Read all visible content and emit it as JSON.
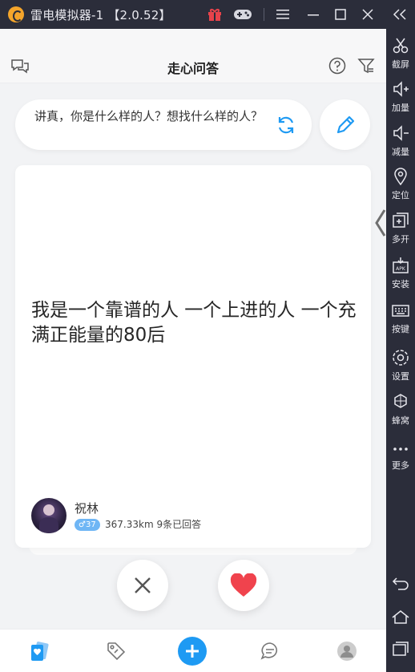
{
  "window": {
    "title": "雷电模拟器-1 【2.0.52】",
    "icons": [
      "app-logo-icon",
      "gift-icon",
      "gamepad-icon",
      "menu-icon",
      "minimize-icon",
      "maximize-icon",
      "close-icon",
      "collapse-sidebar-icon"
    ]
  },
  "sidebar": {
    "items": [
      {
        "label": "截屏",
        "icon": "scissors-icon"
      },
      {
        "label": "加量",
        "icon": "volume-up-icon"
      },
      {
        "label": "减量",
        "icon": "volume-down-icon"
      },
      {
        "label": "定位",
        "icon": "location-icon"
      },
      {
        "label": "多开",
        "icon": "multi-open-icon"
      },
      {
        "label": "安装",
        "icon": "apk-install-icon"
      },
      {
        "label": "按键",
        "icon": "keyboard-icon"
      },
      {
        "label": "设置",
        "icon": "settings-icon"
      },
      {
        "label": "蜂窝",
        "icon": "hive-icon"
      },
      {
        "label": "更多",
        "icon": "more-icon"
      }
    ],
    "nav": [
      "back-icon",
      "home-icon",
      "recent-apps-icon"
    ]
  },
  "app": {
    "title": "走心问答",
    "question": "讲真，你是什么样的人？想找什么样的人？",
    "card": {
      "answer": "我是一个靠谱的人 一个上进的人 一个充满正能量的80后",
      "user_name": "祝林",
      "gender_symbol": "♂",
      "age": "37",
      "distance": "367.33km",
      "answered": "9条已回答"
    }
  },
  "colors": {
    "accent_blue": "#1e9af3",
    "like_red": "#f0434d",
    "badge_blue": "#6fb6f5",
    "chrome": "#2b2d3a"
  }
}
